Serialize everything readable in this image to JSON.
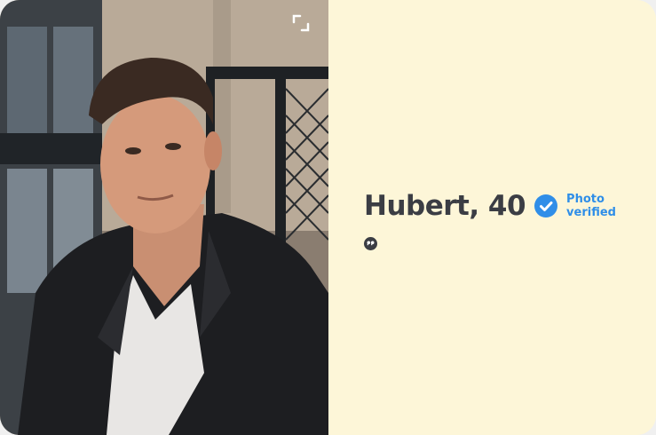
{
  "profile": {
    "name_age": "Hubert, 40",
    "verified_line1": "Photo",
    "verified_line2": "verified"
  },
  "icons": {
    "expand": "expand-icon",
    "verified": "verified-check-icon",
    "quote": "quote-icon"
  },
  "colors": {
    "panel_background": "#fdf6d8",
    "name_text": "#3b3d44",
    "verified_blue": "#2f8ee8"
  }
}
